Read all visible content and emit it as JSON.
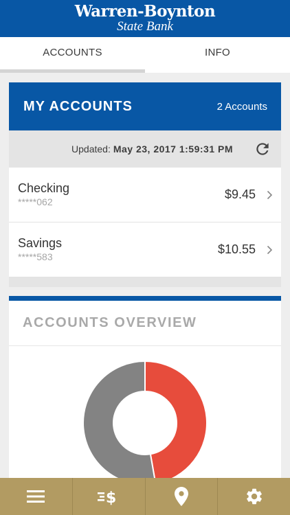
{
  "header": {
    "brand_line1": "Warren-Boynton",
    "brand_line2": "State Bank"
  },
  "tabs": [
    {
      "label": "ACCOUNTS",
      "active": true
    },
    {
      "label": "INFO",
      "active": false
    }
  ],
  "my_accounts": {
    "title": "MY ACCOUNTS",
    "count_label": "2 Accounts",
    "updated_label": "Updated:",
    "updated_value": "May 23, 2017 1:59:31 PM",
    "accounts": [
      {
        "name": "Checking",
        "masked_number": "*****062",
        "balance": "$9.45"
      },
      {
        "name": "Savings",
        "masked_number": "*****583",
        "balance": "$10.55"
      }
    ]
  },
  "overview": {
    "title": "ACCOUNTS OVERVIEW",
    "slices": [
      {
        "account": "Checking",
        "value": 9.45,
        "color": "#e74c3c"
      },
      {
        "account": "Savings",
        "value": 10.55,
        "color": "#838383"
      }
    ]
  },
  "bottom_nav": [
    {
      "icon": "menu-icon"
    },
    {
      "icon": "transfer-money-icon"
    },
    {
      "icon": "location-pin-icon"
    },
    {
      "icon": "settings-gear-icon"
    }
  ],
  "colors": {
    "brand_blue": "#0857a5",
    "nav_gold": "#b29b62",
    "checking_red": "#e74c3c",
    "savings_gray": "#838383"
  }
}
